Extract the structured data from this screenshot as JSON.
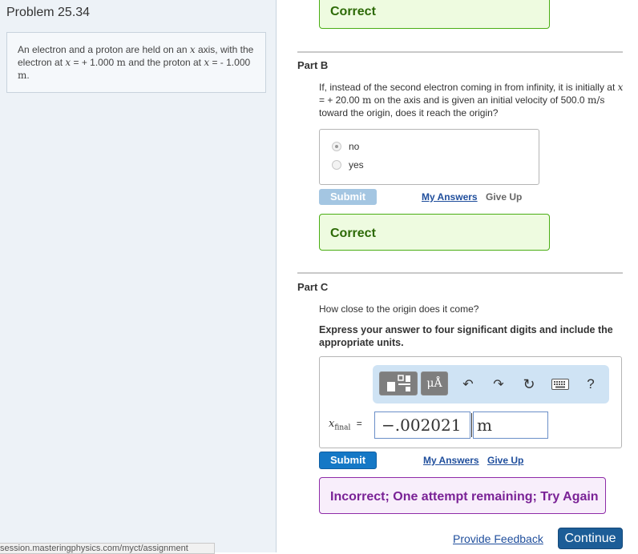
{
  "problem": {
    "title": "Problem 25.34",
    "text_part1": "An electron and a proton are held on an ",
    "var_x": "x",
    "text_part2": " axis, with the electron at ",
    "text_part3": " = + 1.000 ",
    "unit_m": "m",
    "text_part4": " and the proton at ",
    "text_part5": " = - 1.000 ",
    "text_part6": "."
  },
  "status_url": "session.masteringphysics.com/myct/assignment",
  "part_a": {
    "feedback": "Correct"
  },
  "part_b": {
    "label": "Part B",
    "q1": "If, instead of the second electron coming in from infinity, it is initially at ",
    "q_var": "x",
    "q2": " = + 20.00 ",
    "q_unit_m": "m",
    "q3": " on the axis and is given an initial velocity of 500.0 ",
    "q_unit_ms": "m/s",
    "q4": " toward the origin, does it reach the origin?",
    "options": [
      "no",
      "yes"
    ],
    "selected": "no",
    "submit": "Submit",
    "my_answers": "My Answers",
    "give_up": "Give Up",
    "feedback": "Correct"
  },
  "part_c": {
    "label": "Part C",
    "question": "How close to the origin does it come?",
    "instruction": "Express your answer to four significant digits and include the appropriate units.",
    "toolbar": {
      "units_button": "μÅ",
      "undo_icon": "↶",
      "redo_icon": "↷",
      "reset_icon": "↻",
      "help": "?"
    },
    "var_name": "x",
    "var_sub": "final",
    "equals": "=",
    "answer_value": "−.002021",
    "answer_unit": "m",
    "submit": "Submit",
    "my_answers": "My Answers",
    "give_up": "Give Up",
    "feedback": "Incorrect; One attempt remaining; Try Again"
  },
  "footer": {
    "provide_feedback": "Provide Feedback",
    "continue": "Continue"
  }
}
